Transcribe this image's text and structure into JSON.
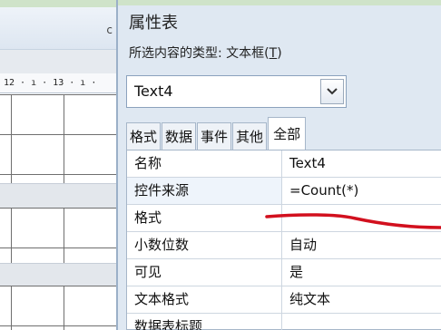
{
  "form_design": {
    "header_letter": "c",
    "ruler_text": "12 · ı · 13 · ı ·"
  },
  "property_sheet": {
    "title": "属性表",
    "selection_type_label": "所选内容的类型: 文本框(",
    "selection_type_accel": "T",
    "selection_type_close": ")",
    "control_selector": {
      "value": "Text4"
    },
    "tabs": [
      {
        "label": "格式",
        "active": false
      },
      {
        "label": "数据",
        "active": false
      },
      {
        "label": "事件",
        "active": false
      },
      {
        "label": "其他",
        "active": false
      },
      {
        "label": "全部",
        "active": true
      }
    ],
    "properties": [
      {
        "name": "名称",
        "value": "Text4"
      },
      {
        "name": "控件来源",
        "value": "=Count(*)"
      },
      {
        "name": "格式",
        "value": ""
      },
      {
        "name": "小数位数",
        "value": "自动"
      },
      {
        "name": "可见",
        "value": "是"
      },
      {
        "name": "文本格式",
        "value": "纯文本"
      },
      {
        "name": "数据表标题",
        "value": ""
      }
    ]
  },
  "annotation": {
    "color": "#d2101e"
  }
}
